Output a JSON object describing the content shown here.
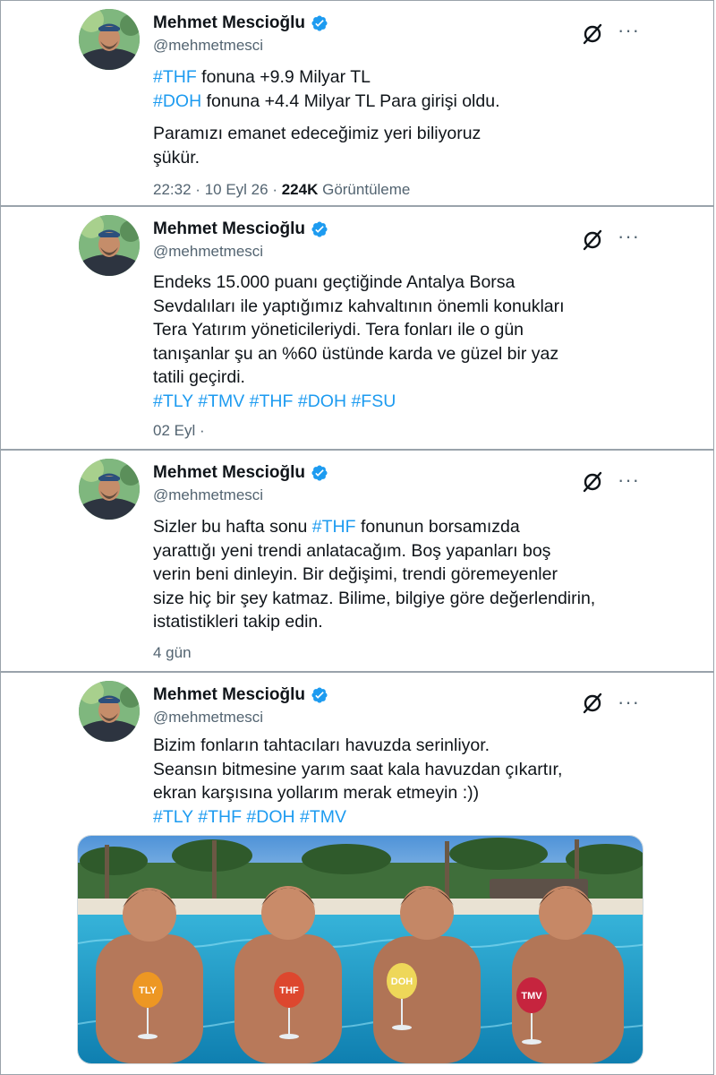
{
  "author": {
    "name": "Mehmet Mescioğlu",
    "handle": "@mehmetmesci"
  },
  "icons": {
    "verified": "verified-badge-icon",
    "grok": "grok-icon",
    "more": "more-icon"
  },
  "colors": {
    "link": "#1d9bf0",
    "verified": "#1d9bf0",
    "secondary_text": "#536471"
  },
  "tweets": [
    {
      "line1_tag": "#THF",
      "line1_text": " fonuna +9.9 Milyar TL",
      "line2_tag": "#DOH",
      "line2_text": " fonuna +4.4 Milyar TL Para girişi oldu.",
      "para2_l1": "Paramızı emanet edeceğimiz yeri biliyoruz",
      "para2_l2": "şükür.",
      "time": "22:32",
      "date": "10 Eyl 26",
      "views": "224K",
      "views_label": "Görüntüleme"
    },
    {
      "lines": [
        "Endeks 15.000 puanı geçtiğinde Antalya Borsa",
        "Sevdalıları ile yaptığımız kahvaltının önemli konukları",
        "Tera Yatırım yöneticileriydi. Tera fonları ile o gün",
        "tanışanlar şu an %60 üstünde karda ve güzel bir yaz",
        "tatili geçirdi."
      ],
      "tags": [
        "#TLY",
        "#TMV",
        "#THF",
        "#DOH",
        "#FSU"
      ],
      "date": "02 Eyl ·"
    },
    {
      "l1_pre": "Sizler bu hafta sonu ",
      "l1_tag": "#THF",
      "l1_post": " fonunun borsamızda",
      "lines": [
        "yarattığı yeni trendi anlatacağım. Boş yapanları boş",
        "verin beni dinleyin. Bir değişimi, trendi göremeyenler",
        "size hiç bir şey katmaz. Bilime, bilgiye göre değerlendirin,",
        "istatistikleri takip edin."
      ],
      "date": "4 gün"
    },
    {
      "lines": [
        "Bizim fonların tahtacıları havuzda serinliyor.",
        "Seansın bitmesine yarım saat kala havuzdan çıkartır,",
        "ekran karşısına yollarım merak etmeyin :))"
      ],
      "tags": [
        "#TLY",
        "#THF",
        "#DOH",
        "#TMV"
      ],
      "image_labels": [
        "TLY",
        "THF",
        "DOH",
        "TMV"
      ]
    }
  ]
}
